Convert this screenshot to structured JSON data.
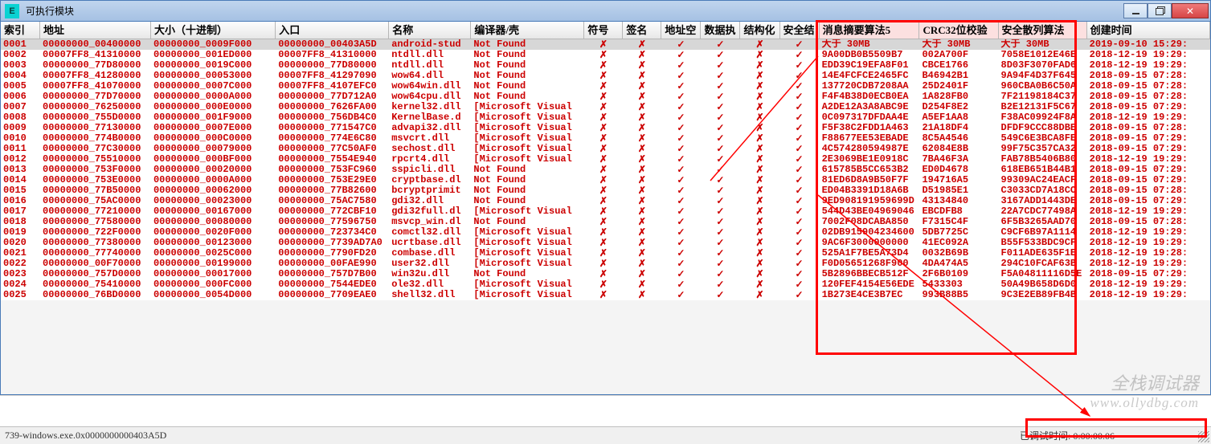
{
  "window": {
    "icon_letter": "E",
    "title": "可执行模块"
  },
  "headers": [
    "索引",
    "地址",
    "大小（十进制）",
    "入口",
    "名称",
    "编译器/壳",
    "符号",
    "签名",
    "地址空",
    "数据执",
    "结构化",
    "安全结",
    "消息摘要算法5",
    "CRC32位校验",
    "安全散列算法",
    "创建时间"
  ],
  "rows": [
    {
      "sel": true,
      "i": "0001",
      "addr": "00000000_00400000",
      "size": "00000000_0009F000",
      "entry": "00000000_00403A5D",
      "name": "android-stud",
      "comp": "Not Found",
      "m": [
        "✗",
        "✗",
        "✓",
        "✓",
        "✗",
        "✓"
      ],
      "md5": "大于 30MB",
      "crc": "大于 30MB",
      "sha": "大于 30MB",
      "ct": "2019-09-10 15:29:"
    },
    {
      "i": "0002",
      "addr": "00007FF8_41310000",
      "size": "00000000_001ED000",
      "entry": "00007FF8_41310000",
      "name": "ntdll.dll",
      "comp": "Not Found",
      "m": [
        "✗",
        "✗",
        "✓",
        "✓",
        "✗",
        "✓"
      ],
      "md5": "9A00DB0B5509B7",
      "crc": "002A700F",
      "sha": "7058E1012E46E",
      "ct": "2018-12-19 19:29:"
    },
    {
      "i": "0003",
      "addr": "00000000_77D80000",
      "size": "00000000_0019C000",
      "entry": "00000000_77D80000",
      "name": "ntdll.dll",
      "comp": "Not Found",
      "m": [
        "✗",
        "✗",
        "✓",
        "✓",
        "✗",
        "✓"
      ],
      "md5": "EDD39C19EFA8F01",
      "crc": "CBCE1766",
      "sha": "8D03F3070FAD6",
      "ct": "2018-12-19 19:29:"
    },
    {
      "i": "0004",
      "addr": "00007FF8_41280000",
      "size": "00000000_00053000",
      "entry": "00007FF8_41297090",
      "name": "wow64.dll",
      "comp": "Not Found",
      "m": [
        "✗",
        "✗",
        "✓",
        "✓",
        "✗",
        "✓"
      ],
      "md5": "14E4FCFCE2465FC",
      "crc": "B46942B1",
      "sha": "9A94F4D37F645",
      "ct": "2018-09-15 07:28:"
    },
    {
      "i": "0005",
      "addr": "00007FF8_41070000",
      "size": "00000000_0007C000",
      "entry": "00007FF8_4107EFC0",
      "name": "wow64win.dll",
      "comp": "Not Found",
      "m": [
        "✗",
        "✗",
        "✓",
        "✓",
        "✗",
        "✓"
      ],
      "md5": "137720CDB7208AA",
      "crc": "25D2401F",
      "sha": "960CBA0B6C50A",
      "ct": "2018-09-15 07:28:"
    },
    {
      "i": "0006",
      "addr": "00000000_77D70000",
      "size": "00000000_0000A000",
      "entry": "00000000_77D712A0",
      "name": "wow64cpu.dll",
      "comp": "Not Found",
      "m": [
        "✗",
        "✗",
        "✓",
        "✓",
        "✗",
        "✓"
      ],
      "md5": "F4F4B38D0ECB0EA",
      "crc": "1A828FB0",
      "sha": "7F21198184C37",
      "ct": "2018-09-15 07:28:"
    },
    {
      "i": "0007",
      "addr": "00000000_76250000",
      "size": "00000000_000E0000",
      "entry": "00000000_7626FA00",
      "name": "kernel32.dll",
      "comp": "[Microsoft Visual",
      "m": [
        "✗",
        "✗",
        "✓",
        "✓",
        "✗",
        "✓"
      ],
      "md5": "A2DE12A3A8ABC9E",
      "crc": "D254F8E2",
      "sha": "B2E12131F5C67",
      "ct": "2018-09-15 07:29:"
    },
    {
      "i": "0008",
      "addr": "00000000_755D0000",
      "size": "00000000_001F9000",
      "entry": "00000000_756DB4C0",
      "name": "KernelBase.d",
      "comp": "[Microsoft Visual",
      "m": [
        "✗",
        "✗",
        "✓",
        "✓",
        "✗",
        "✓"
      ],
      "md5": "0C097317DFDAA4E",
      "crc": "A5EF1AA8",
      "sha": "F38AC09924F8A",
      "ct": "2018-12-19 19:29:"
    },
    {
      "i": "0009",
      "addr": "00000000_77130000",
      "size": "00000000_0007E000",
      "entry": "00000000_771547C0",
      "name": "advapi32.dll",
      "comp": "[Microsoft Visual",
      "m": [
        "✗",
        "✗",
        "✓",
        "✓",
        "✗",
        "✓"
      ],
      "md5": "F5F38C2FDD1A463",
      "crc": "21A18DF4",
      "sha": "DFDF9CCC88DBE",
      "ct": "2018-09-15 07:28:"
    },
    {
      "i": "0010",
      "addr": "00000000_774B0000",
      "size": "00000000_000C0000",
      "entry": "00000000_774E6C80",
      "name": "msvcrt.dll",
      "comp": "[Microsoft Visual",
      "m": [
        "✗",
        "✗",
        "✓",
        "✓",
        "✗",
        "✓"
      ],
      "md5": "F88677EE53EBADE",
      "crc": "8C5A4546",
      "sha": "549C6E3BCA8FE",
      "ct": "2018-09-15 07:29:"
    },
    {
      "i": "0011",
      "addr": "00000000_77C30000",
      "size": "00000000_00079000",
      "entry": "00000000_77C50AF0",
      "name": "sechost.dll",
      "comp": "[Microsoft Visual",
      "m": [
        "✗",
        "✗",
        "✓",
        "✓",
        "✗",
        "✓"
      ],
      "md5": "4C574280594987E",
      "crc": "62084E8B",
      "sha": "99F75C357CA32",
      "ct": "2018-09-15 07:29:"
    },
    {
      "i": "0012",
      "addr": "00000000_75510000",
      "size": "00000000_000BF000",
      "entry": "00000000_7554E940",
      "name": "rpcrt4.dll",
      "comp": "[Microsoft Visual",
      "m": [
        "✗",
        "✗",
        "✓",
        "✓",
        "✗",
        "✓"
      ],
      "md5": "2E3069BE1E0918C",
      "crc": "7BA46F3A",
      "sha": "FAB78B5406B80",
      "ct": "2018-12-19 19:29:"
    },
    {
      "i": "0013",
      "addr": "00000000_753F0000",
      "size": "00000000_00020000",
      "entry": "00000000_753FC960",
      "name": "sspicli.dll",
      "comp": "Not Found",
      "m": [
        "✗",
        "✗",
        "✓",
        "✓",
        "✗",
        "✓"
      ],
      "md5": "615785B5CC653B2",
      "crc": "ED0D4678",
      "sha": "618EB651B44B1",
      "ct": "2018-09-15 07:29:"
    },
    {
      "i": "0014",
      "addr": "00000000_753E0000",
      "size": "00000000_0000A000",
      "entry": "00000000_753E29E0",
      "name": "cryptbase.dl",
      "comp": "Not Found",
      "m": [
        "✗",
        "✗",
        "✓",
        "✓",
        "✗",
        "✓"
      ],
      "md5": "81ED6D8A9B50F7F",
      "crc": "194716A5",
      "sha": "99309AC24EACF",
      "ct": "2018-09-15 07:29:"
    },
    {
      "i": "0015",
      "addr": "00000000_77B50000",
      "size": "00000000_00062000",
      "entry": "00000000_77B82600",
      "name": "bcryptprimit",
      "comp": "Not Found",
      "m": [
        "✗",
        "✗",
        "✓",
        "✓",
        "✗",
        "✓"
      ],
      "md5": "ED04B3391D18A6B",
      "crc": "D51985E1",
      "sha": "C3033CD7A18CC",
      "ct": "2018-09-15 07:28:"
    },
    {
      "i": "0016",
      "addr": "00000000_75AC0000",
      "size": "00000000_00023000",
      "entry": "00000000_75AC7580",
      "name": "gdi32.dll",
      "comp": "Not Found",
      "m": [
        "✗",
        "✗",
        "✓",
        "✓",
        "✗",
        "✓"
      ],
      "md5": "9ED908191959699D",
      "crc": "43134840",
      "sha": "3167ADD1443DE",
      "ct": "2018-09-15 07:29:"
    },
    {
      "i": "0017",
      "addr": "00000000_77210000",
      "size": "00000000_00167000",
      "entry": "00000000_772CBF10",
      "name": "gdi32full.dl",
      "comp": "[Microsoft Visual",
      "m": [
        "✗",
        "✗",
        "✓",
        "✓",
        "✗",
        "✓"
      ],
      "md5": "544D43BE04969046",
      "crc": "EBCDFB8",
      "sha": "22A7CDC77498A",
      "ct": "2018-12-19 19:29:"
    },
    {
      "i": "0018",
      "addr": "00000000_77580000",
      "size": "00000000_00080000",
      "entry": "00000000_77596750",
      "name": "msvcp_win.dl",
      "comp": "Not Found",
      "m": [
        "✗",
        "✗",
        "✓",
        "✓",
        "✗",
        "✓"
      ],
      "md5": "7002F08DCABA850",
      "crc": "F7315C4F",
      "sha": "6F5B3265AAD70",
      "ct": "2018-09-15 07:28:"
    },
    {
      "i": "0019",
      "addr": "00000000_722F0000",
      "size": "00000000_0020F000",
      "entry": "00000000_723734C0",
      "name": "comctl32.dll",
      "comp": "[Microsoft Visual",
      "m": [
        "✗",
        "✗",
        "✓",
        "✓",
        "✗",
        "✓"
      ],
      "md5": "02DB915904234600",
      "crc": "5DB7725C",
      "sha": "C9CF6B97A1114",
      "ct": "2018-12-19 19:29:"
    },
    {
      "i": "0020",
      "addr": "00000000_77380000",
      "size": "00000000_00123000",
      "entry": "00000000_7739AD7A0",
      "name": "ucrtbase.dll",
      "comp": "[Microsoft Visual",
      "m": [
        "✗",
        "✗",
        "✓",
        "✓",
        "✗",
        "✓"
      ],
      "md5": "9AC6F3000000000",
      "crc": "41EC092A",
      "sha": "B55F533BDC9CF",
      "ct": "2018-12-19 19:29:"
    },
    {
      "i": "0021",
      "addr": "00000000_77740000",
      "size": "00000000_0025C000",
      "entry": "00000000_7790FD20",
      "name": "combase.dll",
      "comp": "[Microsoft Visual",
      "m": [
        "✗",
        "✗",
        "✓",
        "✓",
        "✗",
        "✓"
      ],
      "md5": "525A1F7BE5A73D4",
      "crc": "0032B69B",
      "sha": "F011ADE635F1E",
      "ct": "2018-12-19 19:28:"
    },
    {
      "i": "0022",
      "addr": "00000000_00F70000",
      "size": "00000000_00199000",
      "entry": "00000000_00FAE990",
      "name": "user32.dll",
      "comp": "[Microsoft Visual",
      "m": [
        "✗",
        "✗",
        "✓",
        "✓",
        "✗",
        "✓"
      ],
      "md5": "F0D05651268F900",
      "crc": "4DA474A5",
      "sha": "294C10FCAF63B",
      "ct": "2018-12-19 19:29:"
    },
    {
      "i": "0023",
      "addr": "00000000_757D0000",
      "size": "00000000_00017000",
      "entry": "00000000_757D7B00",
      "name": "win32u.dll",
      "comp": "Not Found",
      "m": [
        "✗",
        "✗",
        "✓",
        "✓",
        "✗",
        "✓"
      ],
      "md5": "5B2896BBECB512F",
      "crc": "2F6B0109",
      "sha": "F5A04811116D5E",
      "ct": "2018-09-15 07:29:"
    },
    {
      "i": "0024",
      "addr": "00000000_75410000",
      "size": "00000000_000FC000",
      "entry": "00000000_7544EDE0",
      "name": "ole32.dll",
      "comp": "[Microsoft Visual",
      "m": [
        "✗",
        "✗",
        "✓",
        "✓",
        "✗",
        "✓"
      ],
      "md5": "120FEF4154E56EDE",
      "crc": "5433303",
      "sha": "50A49B658D6D0",
      "ct": "2018-12-19 19:29:"
    },
    {
      "i": "0025",
      "addr": "00000000_76BD0000",
      "size": "00000000_0054D000",
      "entry": "00000000_7709EAE0",
      "name": "shell32.dll",
      "comp": "[Microsoft Visual",
      "m": [
        "✗",
        "✗",
        "✓",
        "✓",
        "✗",
        "✓"
      ],
      "md5": "1B273E4CE3B7EC",
      "crc": "993B88B5",
      "sha": "9C3E2EB89FB4B",
      "ct": "2018-12-19 19:29:"
    }
  ],
  "status": {
    "left": "739-windows.exe.0x0000000000403A5D",
    "right_label": "已调试时间:",
    "right_value": "0:00:00.06"
  },
  "watermark": {
    "line1": "全栈调试器",
    "line2": "www.ollydbg.com"
  }
}
